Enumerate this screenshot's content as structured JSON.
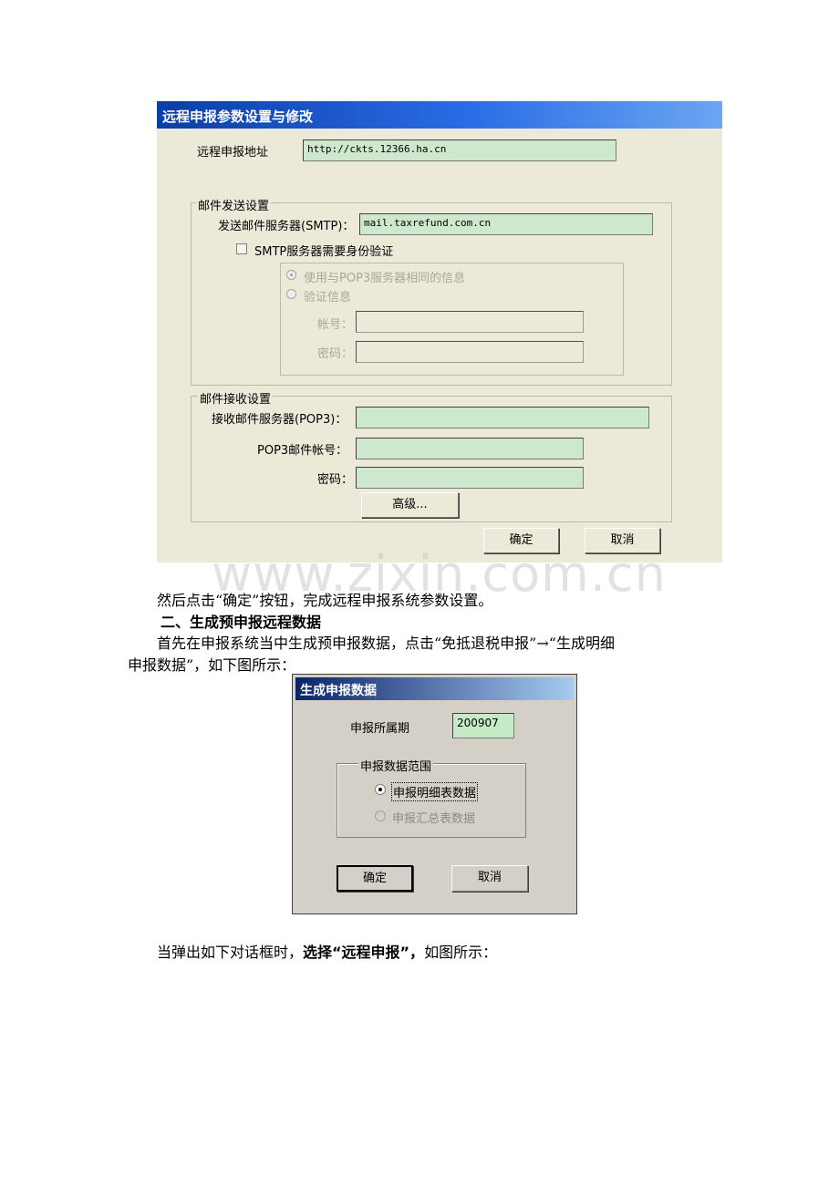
{
  "dialog1": {
    "title": "远程申报参数设置与修改",
    "remote_address_label": "远程申报地址",
    "remote_address_value": "http://ckts.12366.ha.cn",
    "send_group": {
      "legend": "邮件发送设置",
      "smtp_label": "发送邮件服务器(SMTP)：",
      "smtp_value": "mail.taxrefund.com.cn",
      "auth_checkbox_label": "SMTP服务器需要身份验证",
      "radio_same_label": "使用与POP3服务器相同的信息",
      "radio_verify_label": "验证信息",
      "account_label": "帐号：",
      "password_label": "密码："
    },
    "receive_group": {
      "legend": "邮件接收设置",
      "pop3_label": "接收邮件服务器(POP3)：",
      "pop3_account_label": "POP3邮件帐号：",
      "password_label": "密码：",
      "advanced_button": "高级..."
    },
    "ok_button": "确定",
    "cancel_button": "取消"
  },
  "watermark": "www.zixin.com.cn",
  "text": {
    "line1": "然后点击“确定”按钮，完成远程申报系统参数设置。",
    "heading2": "二、生成预申报远程数据",
    "line2a": "首先在申报系统当中生成预申报数据，点击“免抵退税申报”→“生成明细",
    "line2b": "申报数据”，如下图所示：",
    "line3_prefix": "当弹出如下对话框时，",
    "line3_bold": "选择“远程申报”，",
    "line3_suffix": "如图所示："
  },
  "dialog2": {
    "title": "生成申报数据",
    "period_label": "申报所属期",
    "period_value": "200907",
    "group_legend": "申报数据范围",
    "radio_detail": "申报明细表数据",
    "radio_summary": "申报汇总表数据",
    "ok_button": "确定",
    "cancel_button": "取消"
  }
}
